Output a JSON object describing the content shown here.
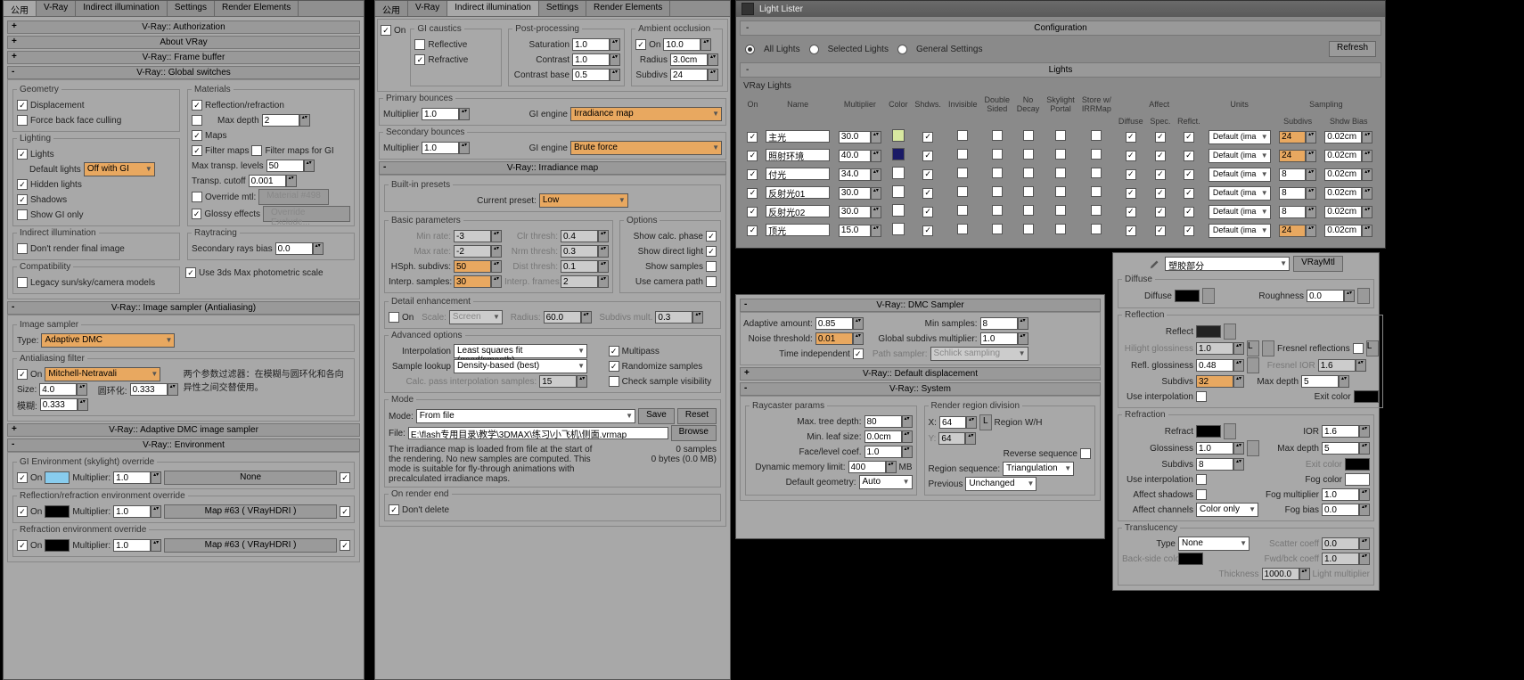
{
  "tabs": [
    "公用",
    "V-Ray",
    "Indirect illumination",
    "Settings",
    "Render Elements"
  ],
  "p1": {
    "auth": "V-Ray:: Authorization",
    "about": "About VRay",
    "fb": "V-Ray:: Frame buffer",
    "gs": "V-Ray:: Global switches",
    "geom": "Geometry",
    "disp": "Displacement",
    "fbfc": "Force back face culling",
    "lighting": "Lighting",
    "lights": "Lights",
    "defl": "Default lights",
    "defl_v": "Off with GI",
    "hidden": "Hidden lights",
    "shadows": "Shadows",
    "gionly": "Show GI only",
    "indir": "Indirect illumination",
    "dnrfi": "Don't render final image",
    "compat": "Compatibility",
    "legacy": "Legacy sun/sky/camera models",
    "mats": "Materials",
    "refl": "Reflection/refraction",
    "maxd": "Max depth",
    "maxd_v": "2",
    "maps": "Maps",
    "fmaps": "Filter maps",
    "fmapsgi": "Filter maps for GI",
    "mtl": "Max transp. levels",
    "mtl_v": "50",
    "tc": "Transp. cutoff",
    "tc_v": "0.001",
    "om": "Override mtl:",
    "om_btn": "Material #498",
    "ge": "Glossy effects",
    "oe": "Override Exclude...",
    "ray": "Raytracing",
    "srb": "Secondary rays bias",
    "srb_v": "0.0",
    "pscale": "Use 3ds Max photometric scale",
    "isamp": "V-Ray:: Image sampler (Antialiasing)",
    "isamp_grp": "Image sampler",
    "type": "Type:",
    "type_v": "Adaptive DMC",
    "af": "Antialiasing filter",
    "on": "On",
    "af_v": "Mitchell-Netravali",
    "af_desc": "两个参数过滤器：在模糊与圆环化和各向异性之间交替使用。",
    "size": "Size:",
    "size_v": "4.0",
    "ring": "圆环化:",
    "ring_v": "0.333",
    "blur": "模糊:",
    "blur_v": "0.333",
    "admc": "V-Ray:: Adaptive DMC image sampler",
    "env": "V-Ray:: Environment",
    "gienv": "GI Environment (skylight) override",
    "mult": "Multiplier:",
    "mult_v": "1.0",
    "none": "None",
    "renv": "Reflection/refraction environment override",
    "map63": "Map #63 ( VRayHDRI )",
    "rfenv": "Refraction environment override"
  },
  "p2": {
    "on": "On",
    "gic": "GI caustics",
    "refl": "Reflective",
    "refr": "Refractive",
    "pp": "Post-processing",
    "sat": "Saturation",
    "sat_v": "1.0",
    "con": "Contrast",
    "con_v": "1.0",
    "conb": "Contrast base",
    "conb_v": "0.5",
    "ao": "Ambient occlusion",
    "ao_on": "On",
    "ao_v": "10.0",
    "rad": "Radius",
    "rad_v": "3.0cm",
    "subd": "Subdivs",
    "subd_v": "24",
    "pb": "Primary bounces",
    "mul": "Multiplier",
    "mul_v": "1.0",
    "gie": "GI engine",
    "gie1": "Irradiance map",
    "sb": "Secondary bounces",
    "gie2": "Brute force",
    "irr": "V-Ray:: Irradiance map",
    "bip": "Built-in presets",
    "cp": "Current preset:",
    "cp_v": "Low",
    "bp": "Basic parameters",
    "minr": "Min rate:",
    "minr_v": "-3",
    "maxr": "Max rate:",
    "maxr_v": "-2",
    "hsub": "HSph. subdivs:",
    "hsub_v": "50",
    "isamp": "Interp. samples:",
    "isamp_v": "30",
    "ct": "Clr thresh:",
    "ct_v": "0.4",
    "nt": "Nrm thresh:",
    "nt_v": "0.3",
    "dt": "Dist thresh:",
    "dt_v": "0.1",
    "if": "Interp. frames:",
    "if_v": "2",
    "opt": "Options",
    "scp": "Show calc. phase",
    "sdl": "Show direct light",
    "ss": "Show samples",
    "ucp": "Use camera path",
    "de": "Detail enhancement",
    "scale": "Scale:",
    "scale_v": "Screen",
    "de_r": "Radius:",
    "de_r_v": "60.0",
    "sm": "Subdivs mult.",
    "sm_v": "0.3",
    "adv": "Advanced options",
    "interp": "Interpolation",
    "interp_v": "Least squares fit (good/smooth)",
    "sl": "Sample lookup",
    "sl_v": "Density-based (best)",
    "cpis": "Calc. pass interpolation samples:",
    "cpis_v": "15",
    "mp": "Multipass",
    "rs": "Randomize samples",
    "csv": "Check sample visibility",
    "mode": "Mode",
    "mode_l": "Mode:",
    "mode_v": "From file",
    "save": "Save",
    "reset": "Reset",
    "file": "File:",
    "file_v": "E:\\flash专用目录\\教学\\3DMAX\\练习\\小飞机\\侧面.vrmap",
    "browse": "Browse",
    "desc": "The irradiance map is loaded from file at the start of the rendering. No new samples are computed. This mode is suitable for fly-through animations with precalculated irradiance maps.",
    "stats": "0 samples\n0 bytes (0.0 MB)",
    "ore": "On render end",
    "dd": "Don't delete"
  },
  "ll": {
    "title": "Light Lister",
    "cfg": "Configuration",
    "al": "All Lights",
    "sl": "Selected Lights",
    "gs": "General Settings",
    "refresh": "Refresh",
    "lights": "Lights",
    "vrl": "VRay Lights",
    "h": {
      "on": "On",
      "name": "Name",
      "mult": "Multiplier",
      "color": "Color",
      "sh": "Shdws.",
      "inv": "Invisible",
      "ds": "Double\nSided",
      "nd": "No\nDecay",
      "sk": "Skylight\nPortal",
      "sw": "Store w/\nIRRMap",
      "diff": "Diffuse",
      "spec": "Spec.",
      "refl": "Reflct.",
      "aff": "Affect",
      "units": "Units",
      "samp": "Sampling",
      "subd": "Subdivs",
      "sb": "Shdw Bias"
    },
    "rows": [
      {
        "n": "主光",
        "m": "30.0",
        "c": "#d8e8a0",
        "s": "24",
        "hl": true,
        "b": "0.02cm"
      },
      {
        "n": "照射环境",
        "m": "40.0",
        "c": "#1a1a66",
        "s": "24",
        "hl": true,
        "b": "0.02cm"
      },
      {
        "n": "付光",
        "m": "34.0",
        "c": "#ffffff",
        "s": "8",
        "hl": false,
        "b": "0.02cm"
      },
      {
        "n": "反射光01",
        "m": "30.0",
        "c": "#ffffff",
        "s": "8",
        "hl": false,
        "b": "0.02cm"
      },
      {
        "n": "反射光02",
        "m": "30.0",
        "c": "#ffffff",
        "s": "8",
        "hl": false,
        "b": "0.02cm"
      },
      {
        "n": "顶光",
        "m": "15.0",
        "c": "#ffffff",
        "s": "24",
        "hl": true,
        "b": "0.02cm"
      }
    ],
    "unit": "Default (ima"
  },
  "p3": {
    "dmc": "V-Ray:: DMC Sampler",
    "aa": "Adaptive amount:",
    "aa_v": "0.85",
    "nt": "Noise threshold:",
    "nt_v": "0.01",
    "ti": "Time independent",
    "ms": "Min samples:",
    "ms_v": "8",
    "gsm": "Global subdivs multiplier:",
    "gsm_v": "1.0",
    "ps": "Path sampler:",
    "ps_v": "Schlick sampling",
    "dd": "V-Ray:: Default displacement",
    "sys": "V-Ray:: System",
    "rc": "Raycaster params",
    "mtd": "Max. tree depth:",
    "mtd_v": "80",
    "mls": "Min. leaf size:",
    "mls_v": "0.0cm",
    "flc": "Face/level coef.",
    "flc_v": "1.0",
    "dml": "Dynamic memory limit:",
    "dml_v": "400",
    "mb": "MB",
    "dg": "Default geometry:",
    "dg_v": "Auto",
    "rr": "Render region division",
    "x": "X:",
    "x_v": "64",
    "y": "Y:",
    "y_v": "64",
    "lock": "L",
    "rwh": "Region W/H",
    "rev": "Reverse sequence",
    "rseq": "Region sequence:",
    "rseq_v": "Triangulation",
    "prev": "Previous",
    "prev_v": "Unchanged"
  },
  "mat": {
    "name": "塑胶部分",
    "type": "VRayMtl",
    "diff": "Diffuse",
    "diff_l": "Diffuse",
    "rough": "Roughness",
    "rough_v": "0.0",
    "refl": "Reflection",
    "refl_l": "Reflect",
    "hg": "Hilight glossiness",
    "hg_v": "1.0",
    "rg": "Refl. glossiness",
    "rg_v": "0.48",
    "sub": "Subdivs",
    "sub_v": "32",
    "ui": "Use interpolation",
    "fr": "Fresnel reflections",
    "fi": "Fresnel IOR",
    "fi_v": "1.6",
    "md": "Max depth",
    "md_v": "5",
    "ec": "Exit color",
    "refr": "Refraction",
    "refr_l": "Refract",
    "ior": "IOR",
    "ior_v": "1.6",
    "gl": "Glossiness",
    "gl_v": "1.0",
    "md2": "Max depth",
    "md2_v": "5",
    "sub2": "Subdivs",
    "sub2_v": "8",
    "ec2": "Exit color",
    "ui2": "Use interpolation",
    "fc": "Fog color",
    "as": "Affect shadows",
    "fm": "Fog multiplier",
    "fm_v": "1.0",
    "ac": "Affect channels",
    "ac_v": "Color only",
    "fb": "Fog bias",
    "fb_v": "0.0",
    "tl": "Translucency",
    "tt": "Type",
    "tt_v": "None",
    "sc": "Scatter coeff",
    "sc_v": "0.0",
    "bsc": "Back-side color",
    "fbc": "Fwd/bck coeff",
    "fbc_v": "1.0",
    "th": "Thickness",
    "th_v": "1000.0",
    "lm": "Light multiplier"
  }
}
